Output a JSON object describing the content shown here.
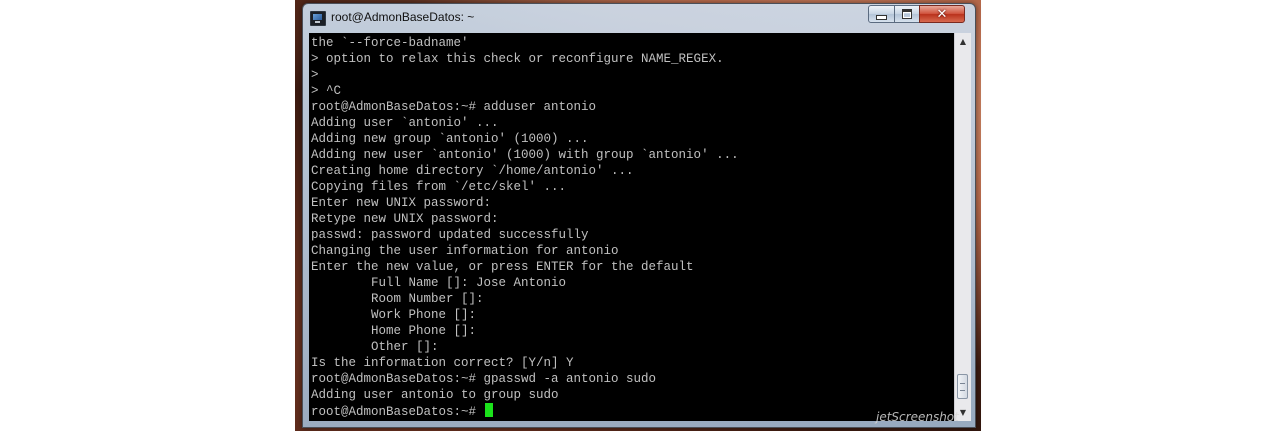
{
  "window": {
    "title": "root@AdmonBaseDatos: ~",
    "icon": "putty-terminal-icon",
    "controls": {
      "minimize": "minimize",
      "maximize": "maximize",
      "close": "✕"
    }
  },
  "terminal": {
    "lines": [
      "the `--force-badname'",
      "> option to relax this check or reconfigure NAME_REGEX.",
      ">",
      "> ^C",
      "root@AdmonBaseDatos:~# adduser antonio",
      "Adding user `antonio' ...",
      "Adding new group `antonio' (1000) ...",
      "Adding new user `antonio' (1000) with group `antonio' ...",
      "Creating home directory `/home/antonio' ...",
      "Copying files from `/etc/skel' ...",
      "Enter new UNIX password:",
      "Retype new UNIX password:",
      "passwd: password updated successfully",
      "Changing the user information for antonio",
      "Enter the new value, or press ENTER for the default",
      "        Full Name []: Jose Antonio",
      "        Room Number []:",
      "        Work Phone []:",
      "        Home Phone []:",
      "        Other []:",
      "Is the information correct? [Y/n] Y",
      "root@AdmonBaseDatos:~# gpasswd -a antonio sudo",
      "Adding user antonio to group sudo"
    ],
    "prompt": "root@AdmonBaseDatos:~# ",
    "cursor_color": "#1be21b",
    "text_color": "#c0c0c0",
    "background": "#000000"
  },
  "scrollbar": {
    "up": "▲",
    "down": "▼"
  },
  "watermark": "jetScreenshot"
}
